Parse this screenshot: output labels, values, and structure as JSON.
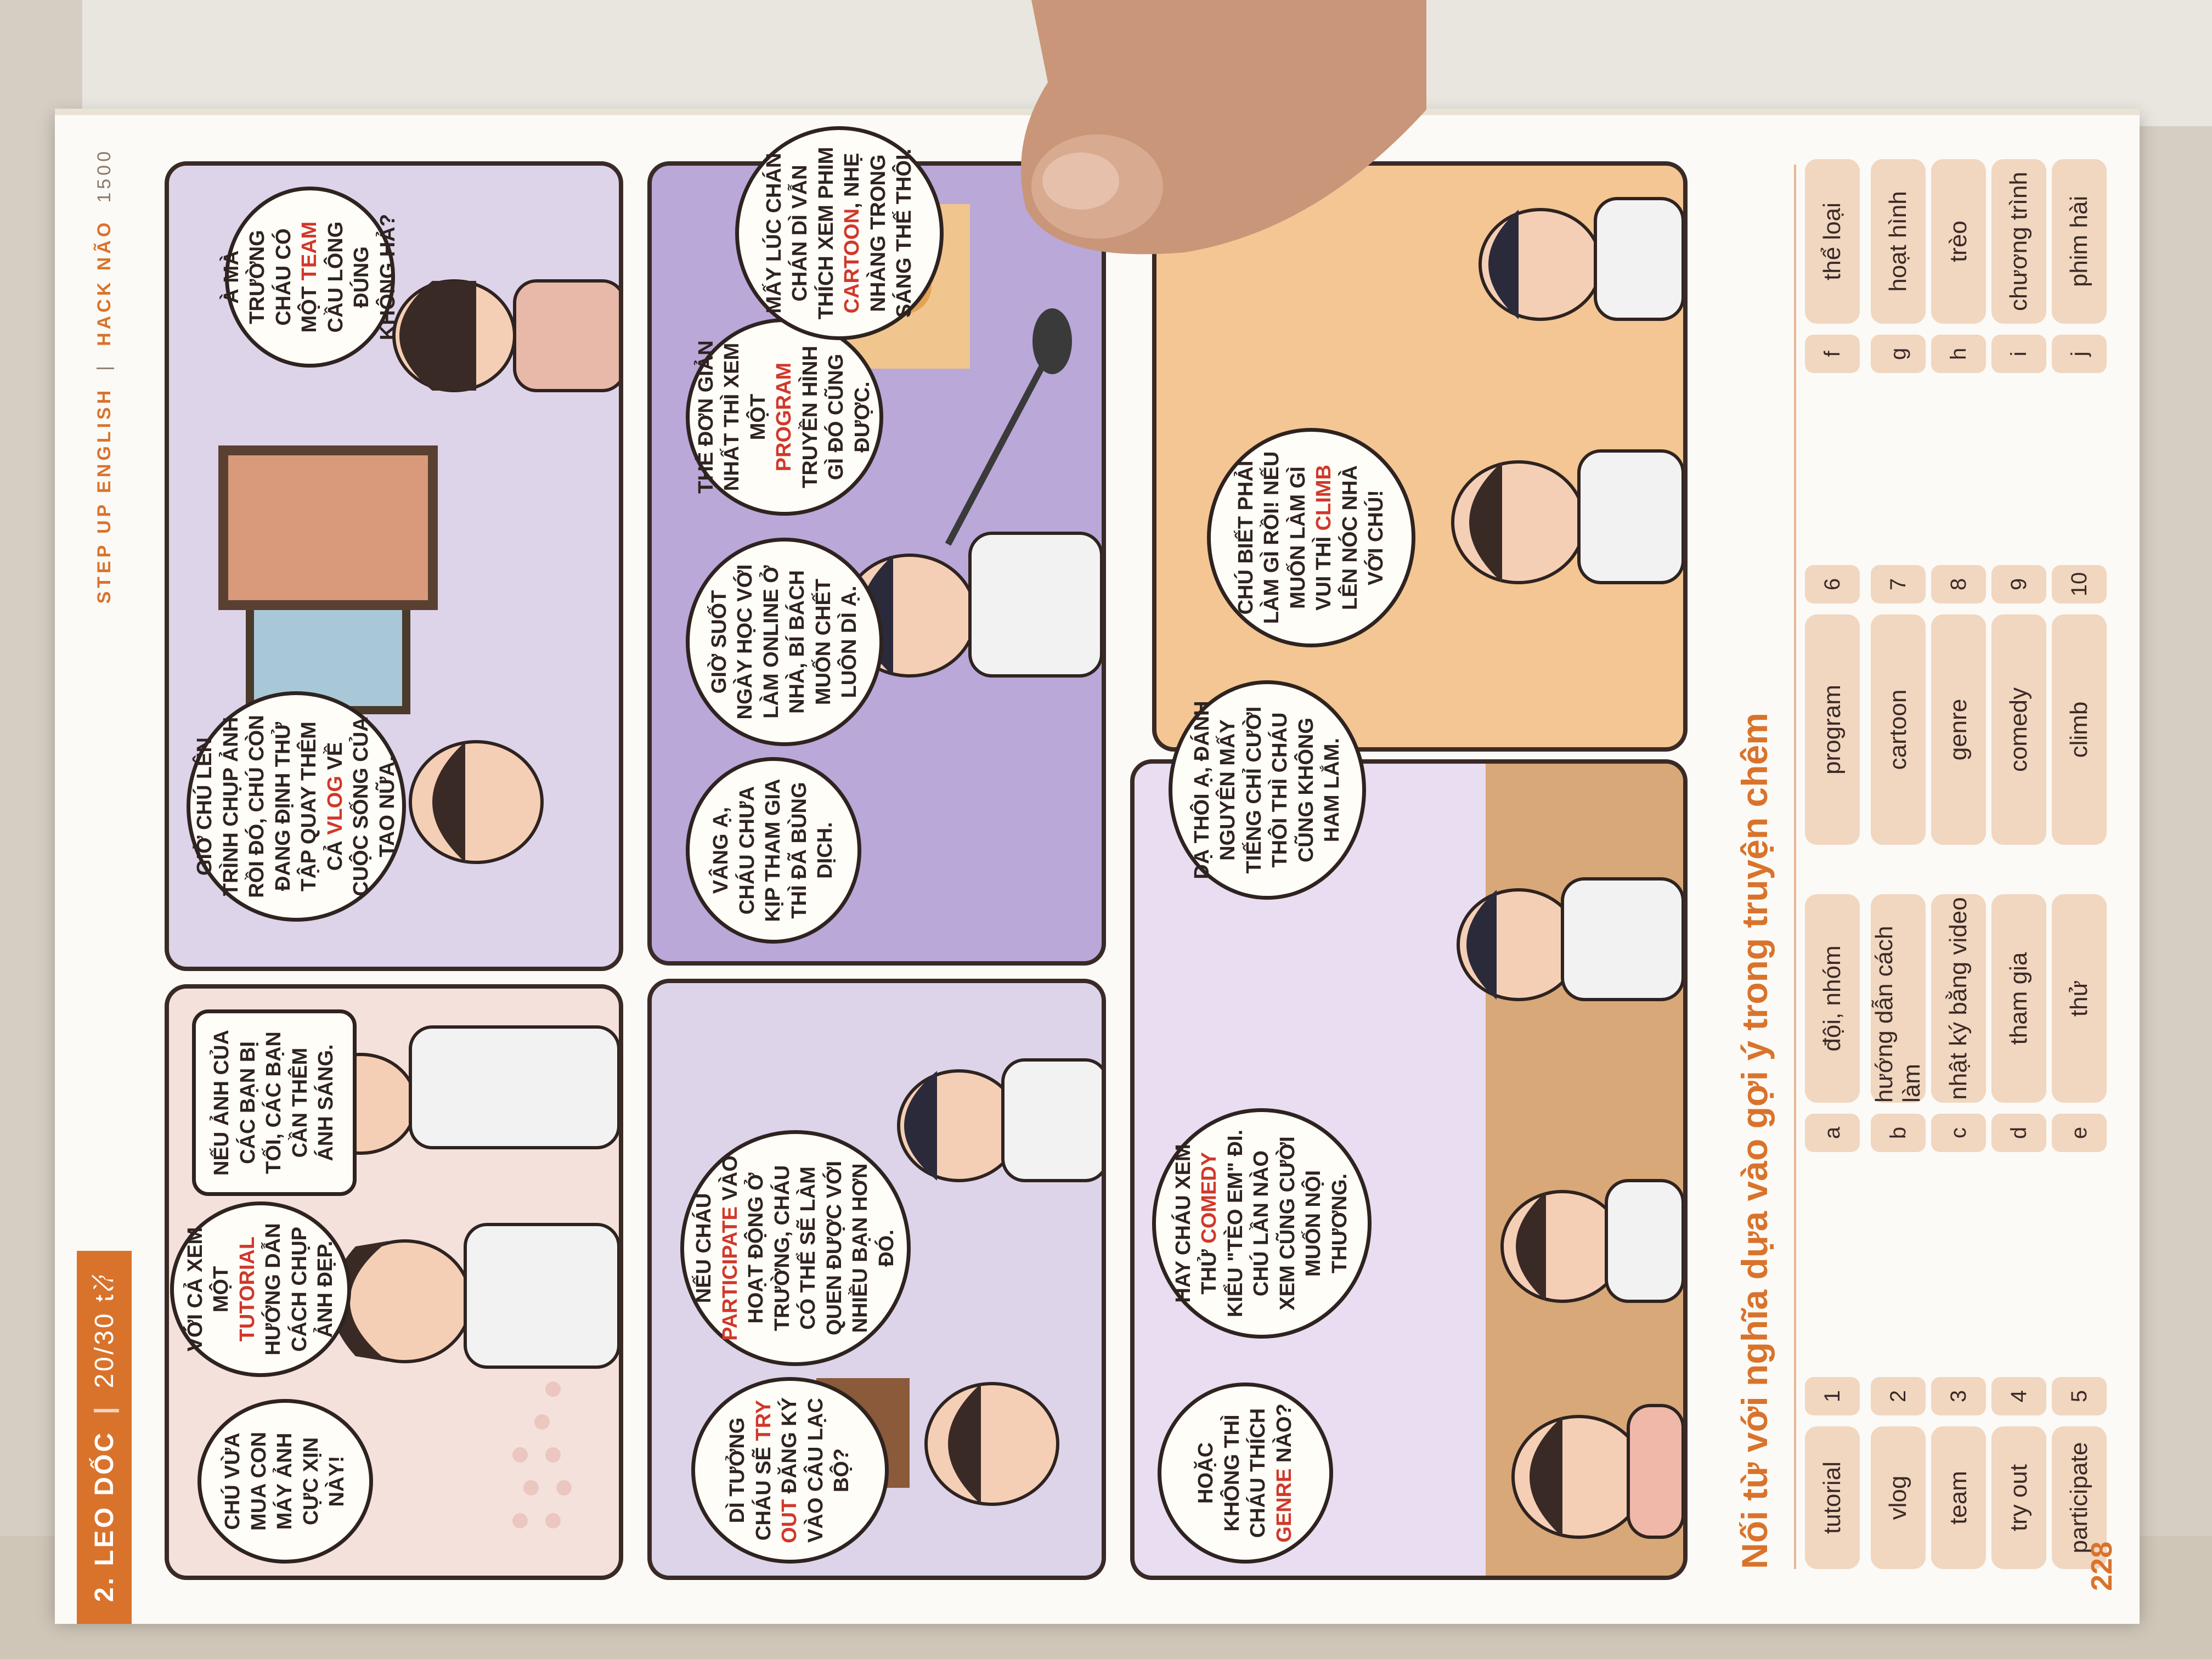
{
  "header": {
    "chapter": "2. LEO DỐC",
    "progress": "20/30 từ",
    "series": "STEP UP ENGLISH",
    "book": "HACK NÃO",
    "book_num": "1500"
  },
  "comic": {
    "bubbles": [
      {
        "pre": "CHÚ VỪA MUA CON MÁY ẢNH CỰC XỊN NÀY!",
        "hl": "",
        "post": ""
      },
      {
        "pre": "VỚI CẢ XEM MỘT ",
        "hl": "TUTORIAL",
        "post": " HƯỚNG DẪN CÁCH CHỤP ẢNH ĐẸP."
      },
      {
        "pre": "NẾU ẢNH CỦA CÁC BẠN BỊ TỐI, CÁC BẠN CẦN THÊM ÁNH SÁNG.",
        "hl": "",
        "post": ""
      },
      {
        "pre": "GIỜ CHÚ LÊN TRÌNH CHỤP ẢNH RỒI ĐÓ, CHÚ CÒN ĐANG ĐỊNH THỬ TẬP QUAY THÊM CẢ ",
        "hl": "VLOG",
        "post": " VỀ CUỘC SỐNG CỦA TAO NỮA."
      },
      {
        "pre": "À MÀ TRƯỜNG CHÁU CÓ MỘT ",
        "hl": "TEAM",
        "post": " CẦU LÔNG ĐÚNG KHÔNG HẢ?"
      },
      {
        "pre": "DÌ TƯỞNG CHÁU SẼ ",
        "hl": "TRY OUT",
        "post": " ĐĂNG KÝ VÀO CÂU LẠC BỘ?"
      },
      {
        "pre": "NẾU CHÁU ",
        "hl": "PARTICIPATE",
        "post": " VÀO HOẠT ĐỘNG Ở TRƯỜNG, CHÁU CÓ THỂ SẼ LÀM QUEN ĐƯỢC VỚI NHIỀU BẠN HƠN ĐÓ."
      },
      {
        "pre": "VÂNG Ạ, CHÁU CHƯA KỊP THAM GIA THÌ ĐÃ BÙNG DỊCH.",
        "hl": "",
        "post": ""
      },
      {
        "pre": "GIỜ SUỐT NGÀY HỌC VỚI LÀM ONLINE Ở NHÀ, BÍ BÁCH MUỐN CHẾT LUÔN DÌ Ạ.",
        "hl": "",
        "post": ""
      },
      {
        "pre": "THẾ ĐƠN GIẢN NHẤT THÌ XEM MỘT ",
        "hl": "PROGRAM",
        "post": " TRUYỀN HÌNH GÌ ĐÓ CŨNG ĐƯỢC."
      },
      {
        "pre": "MẤY LÚC CHÁN CHÁN DÌ VẪN THÍCH XEM PHIM ",
        "hl": "CARTOON",
        "post": ", NHẸ NHÀNG TRONG SÁNG THẾ THÔI."
      },
      {
        "pre": "HOẶC KHÔNG THÌ CHÁU THÍCH ",
        "hl": "GENRE",
        "post": " NÀO?"
      },
      {
        "pre": "HAY CHÁU XEM THỬ ",
        "hl": "COMEDY",
        "post": " KIỂU \"TÈO EM\" ĐI. CHÚ LẦN NÀO XEM CŨNG CƯỜI MUỐN NỘI THƯƠNG."
      },
      {
        "pre": "DẠ THÔI Ạ, ĐÁNH NGUYÊN MẤY TIẾNG CHỈ CƯỜI THÔI THÌ CHÁU CŨNG KHÔNG HAM LẮM.",
        "hl": "",
        "post": ""
      },
      {
        "pre": "CHÚ BIẾT PHẢI LÀM GÌ RỒI! NẾU MUỐN LÀM GÌ VUI THÌ ",
        "hl": "CLIMB",
        "post": " LÊN NÓC NHÀ VỚI CHÚ!"
      }
    ]
  },
  "exercise": {
    "title": "Nối từ với nghĩa dựa vào gợi ý trong truyện chêm",
    "left_words": [
      "tutorial",
      "vlog",
      "team",
      "try out",
      "participate",
      "program",
      "cartoon",
      "genre",
      "comedy",
      "climb"
    ],
    "left_numbers": [
      "1",
      "2",
      "3",
      "4",
      "5",
      "6",
      "7",
      "8",
      "9",
      "10"
    ],
    "right_letters": [
      "a",
      "b",
      "c",
      "d",
      "e",
      "f",
      "g",
      "h",
      "i",
      "j"
    ],
    "right_meanings": [
      "đội, nhóm",
      "hướng dẫn cách làm",
      "nhật ký bằng video",
      "tham gia",
      "thử",
      "thể loại",
      "hoạt hình",
      "trèo",
      "chương trình",
      "phim hài"
    ]
  },
  "page_number": "228",
  "colors": {
    "accent": "#d9732c",
    "highlight": "#d0382b",
    "pill": "#f1d6c0",
    "panel_purple": "#c9bfe0",
    "panel_pink": "#f3d9d2",
    "panel_peach": "#f4c89a"
  }
}
